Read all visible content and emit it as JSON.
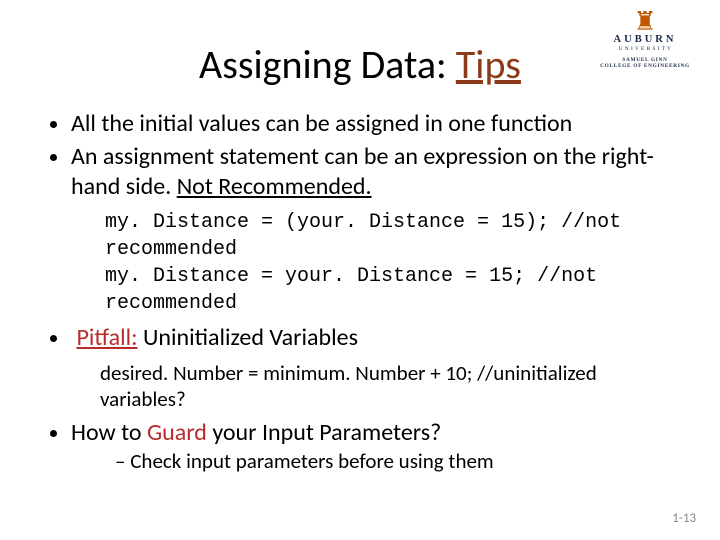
{
  "logo": {
    "university": "AUBURN",
    "tagline": "U N I V E R S I T Y",
    "college_line1": "SAMUEL GINN",
    "college_line2": "COLLEGE OF ENGINEERING"
  },
  "title": {
    "plain": "Assigning Data: ",
    "accent": "Tips"
  },
  "bullets": {
    "b1": "All the initial values can be assigned in one function",
    "b2_part1": "An assignment statement can be an expression on the right-hand side. ",
    "b2_part2": "Not Recommended."
  },
  "code": {
    "line1": "my. Distance = (your. Distance = 15);  //not recommended",
    "line2": "my. Distance = your. Distance = 15;   //not recommended"
  },
  "pitfall": {
    "label": "Pitfall:",
    "text": " Uninitialized Variables",
    "example": "desired. Number  = minimum. Number + 10; //uninitialized variables?"
  },
  "guard": {
    "prefix": " How to ",
    "word": "Guard",
    "suffix": " your Input Parameters?",
    "sub": "Check input parameters before using them"
  },
  "page": "1-13"
}
